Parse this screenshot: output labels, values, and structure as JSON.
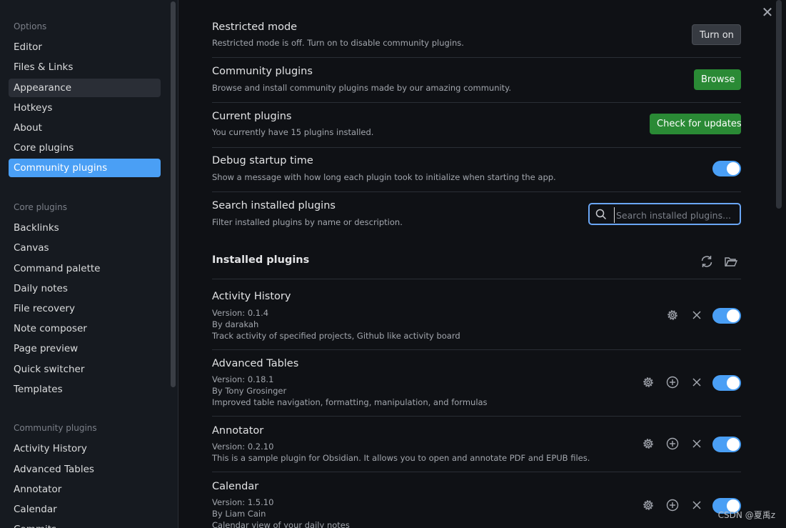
{
  "sidebar": {
    "options_heading": "Options",
    "options": [
      "Editor",
      "Files & Links",
      "Appearance",
      "Hotkeys",
      "About",
      "Core plugins",
      "Community plugins"
    ],
    "core_heading": "Core plugins",
    "core": [
      "Backlinks",
      "Canvas",
      "Command palette",
      "Daily notes",
      "File recovery",
      "Note composer",
      "Page preview",
      "Quick switcher",
      "Templates"
    ],
    "community_heading": "Community plugins",
    "community": [
      "Activity History",
      "Advanced Tables",
      "Annotator",
      "Calendar",
      "Commits"
    ]
  },
  "settings": {
    "restricted": {
      "name": "Restricted mode",
      "desc": "Restricted mode is off. Turn on to disable community plugins.",
      "button": "Turn on"
    },
    "community": {
      "name": "Community plugins",
      "desc": "Browse and install community plugins made by our amazing community.",
      "button": "Browse"
    },
    "current": {
      "name": "Current plugins",
      "desc": "You currently have 15 plugins installed.",
      "button": "Check for updates"
    },
    "debug": {
      "name": "Debug startup time",
      "desc": "Show a message with how long each plugin took to initialize when starting the app.",
      "enabled": true
    },
    "search": {
      "name": "Search installed plugins",
      "desc": "Filter installed plugins by name or description.",
      "placeholder": "Search installed plugins..."
    }
  },
  "installed": {
    "title": "Installed plugins",
    "plugins": [
      {
        "name": "Activity History",
        "version": "Version: 0.1.4",
        "author": "By darakah",
        "desc": "Track activity of specified projects, Github like activity board",
        "enabled": true
      },
      {
        "name": "Advanced Tables",
        "version": "Version: 0.18.1",
        "author": "By Tony Grosinger",
        "desc": "Improved table navigation, formatting, manipulation, and formulas",
        "enabled": true
      },
      {
        "name": "Annotator",
        "version": "Version: 0.2.10",
        "desc": "This is a sample plugin for Obsidian. It allows you to open and annotate PDF and EPUB files.",
        "enabled": true
      },
      {
        "name": "Calendar",
        "version": "Version: 1.5.10",
        "author": "By Liam Cain",
        "desc": "Calendar view of your daily notes",
        "enabled": true
      }
    ]
  },
  "colors": {
    "accent": "#4a9ff5",
    "green": "#2a8a35",
    "background": "#0f1115",
    "sidebar": "#161a20"
  },
  "watermark": "CSDN @夏禹z"
}
